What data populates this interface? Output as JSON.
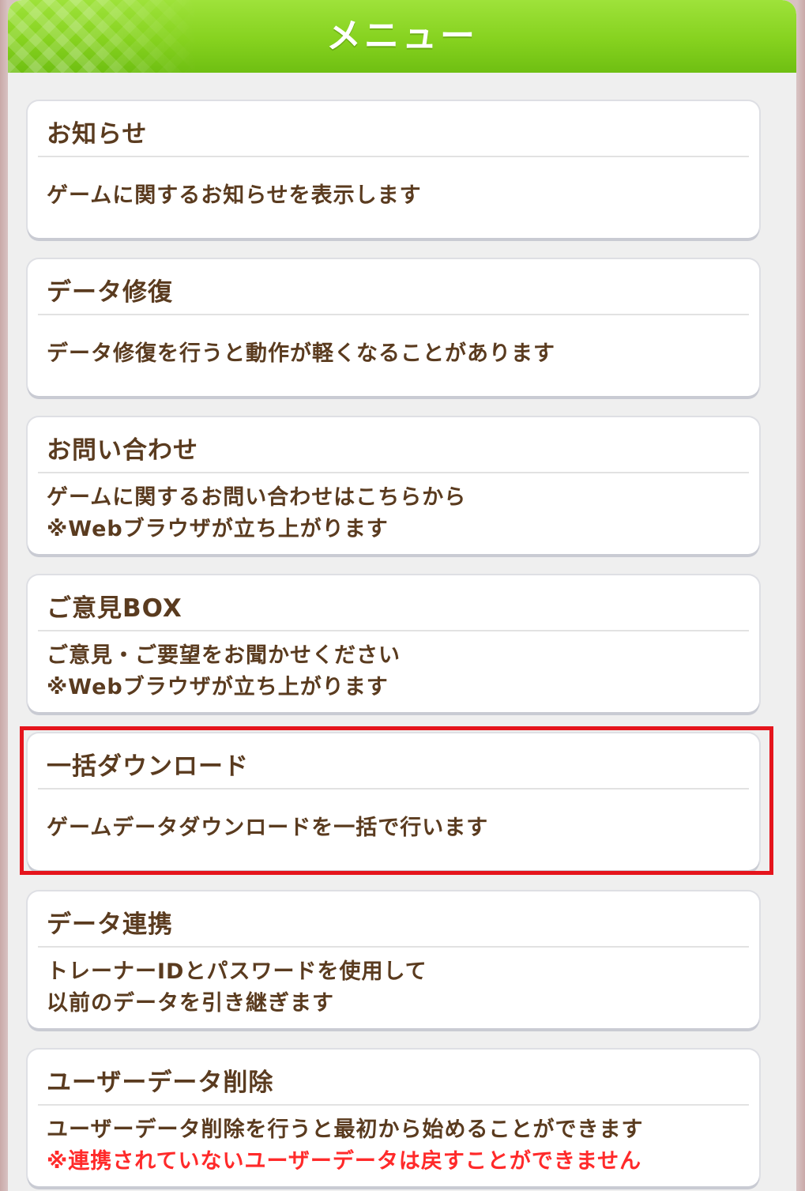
{
  "header": {
    "title": "メニュー"
  },
  "menu": {
    "items": [
      {
        "title": "お知らせ",
        "lines": [
          "ゲームに関するお知らせを表示します"
        ]
      },
      {
        "title": "データ修復",
        "lines": [
          "データ修復を行うと動作が軽くなることがあります"
        ]
      },
      {
        "title": "お問い合わせ",
        "lines": [
          "ゲームに関するお問い合わせはこちらから",
          "※Webブラウザが立ち上がります"
        ]
      },
      {
        "title": "ご意見BOX",
        "lines": [
          "ご意見・ご要望をお聞かせください",
          "※Webブラウザが立ち上がります"
        ]
      },
      {
        "title": "一括ダウンロード",
        "lines": [
          "ゲームデータダウンロードを一括で行います"
        ],
        "highlighted": true
      },
      {
        "title": "データ連携",
        "lines": [
          "トレーナーIDとパスワードを使用して",
          "以前のデータを引き継ぎます"
        ]
      },
      {
        "title": "ユーザーデータ削除",
        "lines": [
          "ユーザーデータ削除を行うと最初から始めることができます",
          "※連携されていないユーザーデータは戻すことができません"
        ]
      }
    ]
  },
  "colors": {
    "header_green": "#86d21f",
    "text_brown": "#5a3b1f",
    "warning_red": "#ff2a2a",
    "highlight_red": "#e5141c"
  }
}
